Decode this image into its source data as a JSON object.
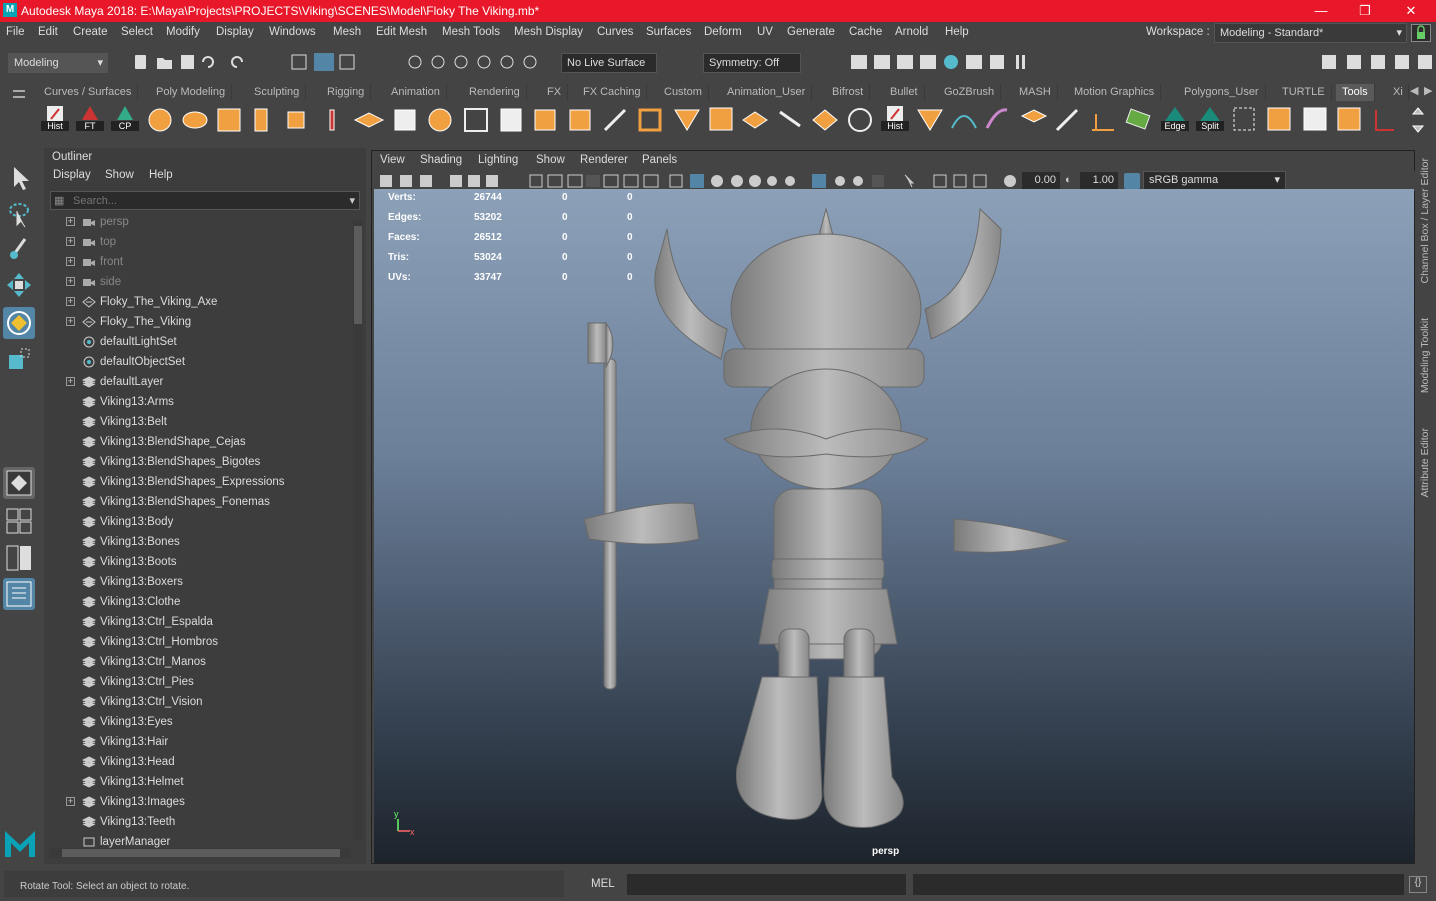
{
  "titlebar": {
    "title": "Autodesk Maya 2018: E:\\Maya\\Projects\\PROJECTS\\Viking\\SCENES\\Model\\Floky The Viking.mb*",
    "minimize": "—",
    "maximize": "❐",
    "close": "✕"
  },
  "menus": [
    "File",
    "Edit",
    "Create",
    "Select",
    "Modify",
    "Display",
    "Windows",
    "Mesh",
    "Edit Mesh",
    "Mesh Tools",
    "Mesh Display",
    "Curves",
    "Surfaces",
    "Deform",
    "UV",
    "Generate",
    "Cache",
    "Arnold",
    "Help"
  ],
  "workspace": {
    "label": "Workspace :",
    "value": "Modeling - Standard*"
  },
  "statusline": {
    "menuset": "Modeling",
    "live_surface": "No Live Surface",
    "symmetry": "Symmetry: Off"
  },
  "shelf_tabs": [
    "Curves / Surfaces",
    "Poly Modeling",
    "Sculpting",
    "Rigging",
    "Animation",
    "Rendering",
    "FX",
    "FX Caching",
    "Custom",
    "Animation_User",
    "Bifrost",
    "Bullet",
    "GoZBrush",
    "MASH",
    "Motion Graphics",
    "Polygons_User",
    "TURTLE",
    "Tools",
    "Xi"
  ],
  "shelf_active": "Tools",
  "shelf_labels": {
    "hist": "Hist",
    "ft": "FT",
    "cp": "CP",
    "hist2": "Hist",
    "edge": "Edge",
    "split": "Split"
  },
  "outliner": {
    "title": "Outliner",
    "menus": [
      "Display",
      "Show",
      "Help"
    ],
    "search_placeholder": "Search...",
    "items": [
      {
        "label": "persp",
        "icon": "camera",
        "expand": true,
        "dim": true
      },
      {
        "label": "top",
        "icon": "camera",
        "expand": true,
        "dim": true
      },
      {
        "label": "front",
        "icon": "camera",
        "expand": true,
        "dim": true
      },
      {
        "label": "side",
        "icon": "camera",
        "expand": true,
        "dim": true
      },
      {
        "label": "Floky_The_Viking_Axe",
        "icon": "group",
        "expand": true
      },
      {
        "label": "Floky_The_Viking",
        "icon": "group",
        "expand": true
      },
      {
        "label": "defaultLightSet",
        "icon": "set",
        "expand": false
      },
      {
        "label": "defaultObjectSet",
        "icon": "set",
        "expand": false
      },
      {
        "label": "defaultLayer",
        "icon": "layer",
        "expand": true
      },
      {
        "label": "Viking13:Arms",
        "icon": "layer",
        "expand": false
      },
      {
        "label": "Viking13:Belt",
        "icon": "layer",
        "expand": false
      },
      {
        "label": "Viking13:BlendShape_Cejas",
        "icon": "layer",
        "expand": false
      },
      {
        "label": "Viking13:BlendShapes_Bigotes",
        "icon": "layer",
        "expand": false
      },
      {
        "label": "Viking13:BlendShapes_Expressions",
        "icon": "layer",
        "expand": false
      },
      {
        "label": "Viking13:BlendShapes_Fonemas",
        "icon": "layer",
        "expand": false
      },
      {
        "label": "Viking13:Body",
        "icon": "layer",
        "expand": false
      },
      {
        "label": "Viking13:Bones",
        "icon": "layer",
        "expand": false
      },
      {
        "label": "Viking13:Boots",
        "icon": "layer",
        "expand": false
      },
      {
        "label": "Viking13:Boxers",
        "icon": "layer",
        "expand": false
      },
      {
        "label": "Viking13:Clothe",
        "icon": "layer",
        "expand": false
      },
      {
        "label": "Viking13:Ctrl_Espalda",
        "icon": "layer",
        "expand": false
      },
      {
        "label": "Viking13:Ctrl_Hombros",
        "icon": "layer",
        "expand": false
      },
      {
        "label": "Viking13:Ctrl_Manos",
        "icon": "layer",
        "expand": false
      },
      {
        "label": "Viking13:Ctrl_Pies",
        "icon": "layer",
        "expand": false
      },
      {
        "label": "Viking13:Ctrl_Vision",
        "icon": "layer",
        "expand": false
      },
      {
        "label": "Viking13:Eyes",
        "icon": "layer",
        "expand": false
      },
      {
        "label": "Viking13:Hair",
        "icon": "layer",
        "expand": false
      },
      {
        "label": "Viking13:Head",
        "icon": "layer",
        "expand": false
      },
      {
        "label": "Viking13:Helmet",
        "icon": "layer",
        "expand": false
      },
      {
        "label": "Viking13:Images",
        "icon": "layer",
        "expand": true
      },
      {
        "label": "Viking13:Teeth",
        "icon": "layer",
        "expand": false
      },
      {
        "label": "layerManager",
        "icon": "node",
        "expand": false
      }
    ]
  },
  "viewport": {
    "menus": [
      "View",
      "Shading",
      "Lighting",
      "Show",
      "Renderer",
      "Panels"
    ],
    "exposure": "0.00",
    "gamma": "1.00",
    "colorspace": "sRGB gamma",
    "camera": "persp",
    "axis_y": "y",
    "axis_x": "x",
    "hud": [
      {
        "label": "Verts:",
        "v1": "26744",
        "v2": "0",
        "v3": "0"
      },
      {
        "label": "Edges:",
        "v1": "53202",
        "v2": "0",
        "v3": "0"
      },
      {
        "label": "Faces:",
        "v1": "26512",
        "v2": "0",
        "v3": "0"
      },
      {
        "label": "Tris:",
        "v1": "53024",
        "v2": "0",
        "v3": "0"
      },
      {
        "label": "UVs:",
        "v1": "33747",
        "v2": "0",
        "v3": "0"
      }
    ]
  },
  "right_tabs": [
    "Channel Box / Layer Editor",
    "Modeling Toolkit",
    "Attribute Editor"
  ],
  "commandline": {
    "lang": "MEL",
    "help": "Rotate Tool: Select an object to rotate."
  },
  "colors": {
    "title_bg": "#e8182a",
    "accent": "#5285a6",
    "maya_logo": "#0aa3b5"
  }
}
